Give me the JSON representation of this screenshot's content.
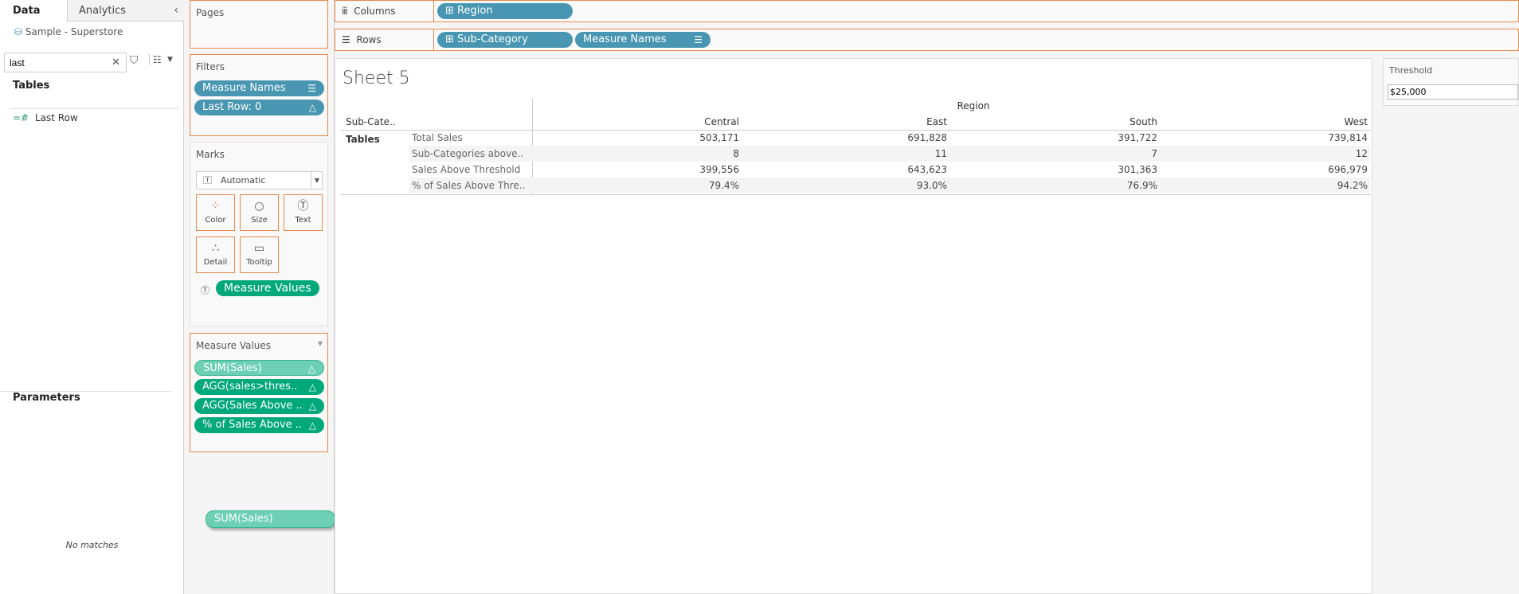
{
  "data_pane": {
    "tab_data": "Data",
    "tab_analytics": "Analytics",
    "datasource": "Sample - Superstore",
    "search_value": "last",
    "tables_heading": "Tables",
    "fields": [
      {
        "label": "Last Row",
        "icon": "calculated-measure-icon"
      }
    ],
    "parameters_heading": "Parameters",
    "no_matches": "No matches"
  },
  "pages": {
    "title": "Pages"
  },
  "filters": {
    "title": "Filters",
    "pills": [
      {
        "label": "Measure Names",
        "icon": "sort-icon"
      },
      {
        "label": "Last Row: 0",
        "icon": "delta-icon"
      }
    ]
  },
  "marks": {
    "title": "Marks",
    "type": "Automatic",
    "buttons": [
      "Color",
      "Size",
      "Text",
      "Detail",
      "Tooltip"
    ],
    "text_pill": "Measure Values"
  },
  "measure_values": {
    "title": "Measure Values",
    "pills": [
      "SUM(Sales)",
      "AGG(sales>thres..",
      "AGG(Sales Above ..",
      "% of Sales Above .."
    ]
  },
  "drag_pill": "SUM(Sales)",
  "shelves": {
    "columns_label": "Columns",
    "columns": [
      "Region"
    ],
    "rows_label": "Rows",
    "rows": [
      "Sub-Category",
      "Measure Names"
    ]
  },
  "sheet": {
    "title": "Sheet 5",
    "col_group": "Region",
    "row_header": "Sub-Cate..",
    "regions": [
      "Central",
      "East",
      "South",
      "West"
    ],
    "category": "Tables",
    "rows": [
      {
        "label": "Total Sales",
        "values": [
          "503,171",
          "691,828",
          "391,722",
          "739,814"
        ]
      },
      {
        "label": "Sub-Categories above..",
        "values": [
          "8",
          "11",
          "7",
          "12"
        ]
      },
      {
        "label": "Sales Above Threshold",
        "values": [
          "399,556",
          "643,623",
          "301,363",
          "696,979"
        ]
      },
      {
        "label": "% of Sales Above Thre..",
        "values": [
          "79.4%",
          "93.0%",
          "76.9%",
          "94.2%"
        ]
      }
    ]
  },
  "threshold": {
    "title": "Threshold",
    "value": "$25,000"
  },
  "colors": {
    "accent": "#e8894b",
    "blue_pill": "#4996b2",
    "green_pill": "#00a87a"
  }
}
